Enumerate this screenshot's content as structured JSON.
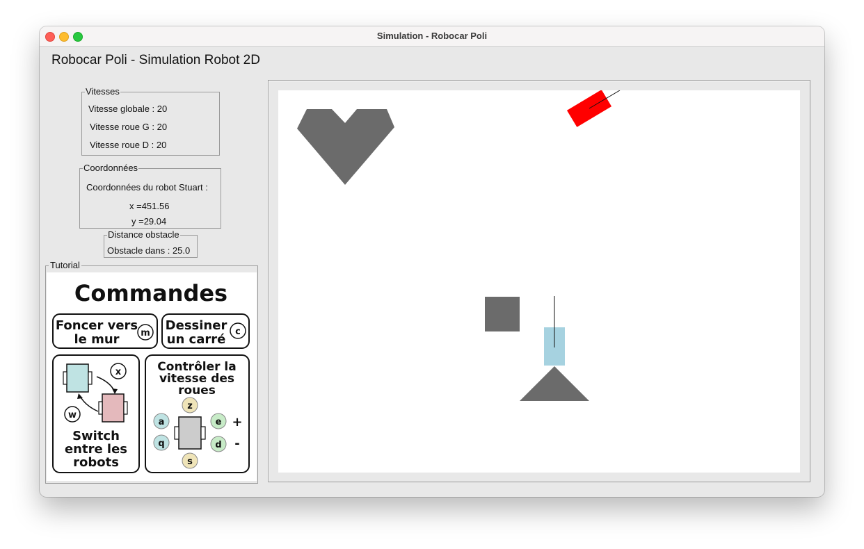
{
  "window": {
    "title": "Simulation - Robocar Poli",
    "app_title": "Robocar Poli - Simulation Robot 2D"
  },
  "vitesses": {
    "legend": "Vitesses",
    "globale": "Vitesse globale : 20",
    "roue_g": "Vitesse roue G : 20",
    "roue_d": "Vitesse roue D : 20"
  },
  "coordonnees": {
    "legend": "Coordonnées",
    "label": "Coordonnées du robot Stuart :",
    "x": "x =451.56",
    "y": "y =29.04"
  },
  "distance": {
    "legend": "Distance obstacle",
    "value": "Obstacle dans : 25.0"
  },
  "tutorial": {
    "legend": "Tutorial",
    "title": "Commandes",
    "card1_line1": "Foncer vers",
    "card1_line2": "le mur",
    "card1_key": "m",
    "card2_line1": "Dessiner",
    "card2_line2": "un carré",
    "card2_key": "c",
    "switch_key_x": "x",
    "switch_key_w": "w",
    "switch_line1": "Switch",
    "switch_line2": "entre les",
    "switch_line3": "robots",
    "speed_line1": "Contrôler la",
    "speed_line2": "vitesse des",
    "speed_line3": "roues",
    "key_z": "z",
    "key_a": "a",
    "key_e": "e",
    "key_q": "q",
    "key_d": "d",
    "key_s": "s",
    "plus": "+",
    "minus": "-"
  },
  "colors": {
    "obstacle": "#6b6b6b",
    "robot_red": "#ff0000",
    "robot_blue": "#a6d2e0",
    "key_teal": "#bfe3e3",
    "key_green": "#c7ebc7",
    "key_yellow": "#efe4b8",
    "robot_pink": "#e4b9bc"
  }
}
